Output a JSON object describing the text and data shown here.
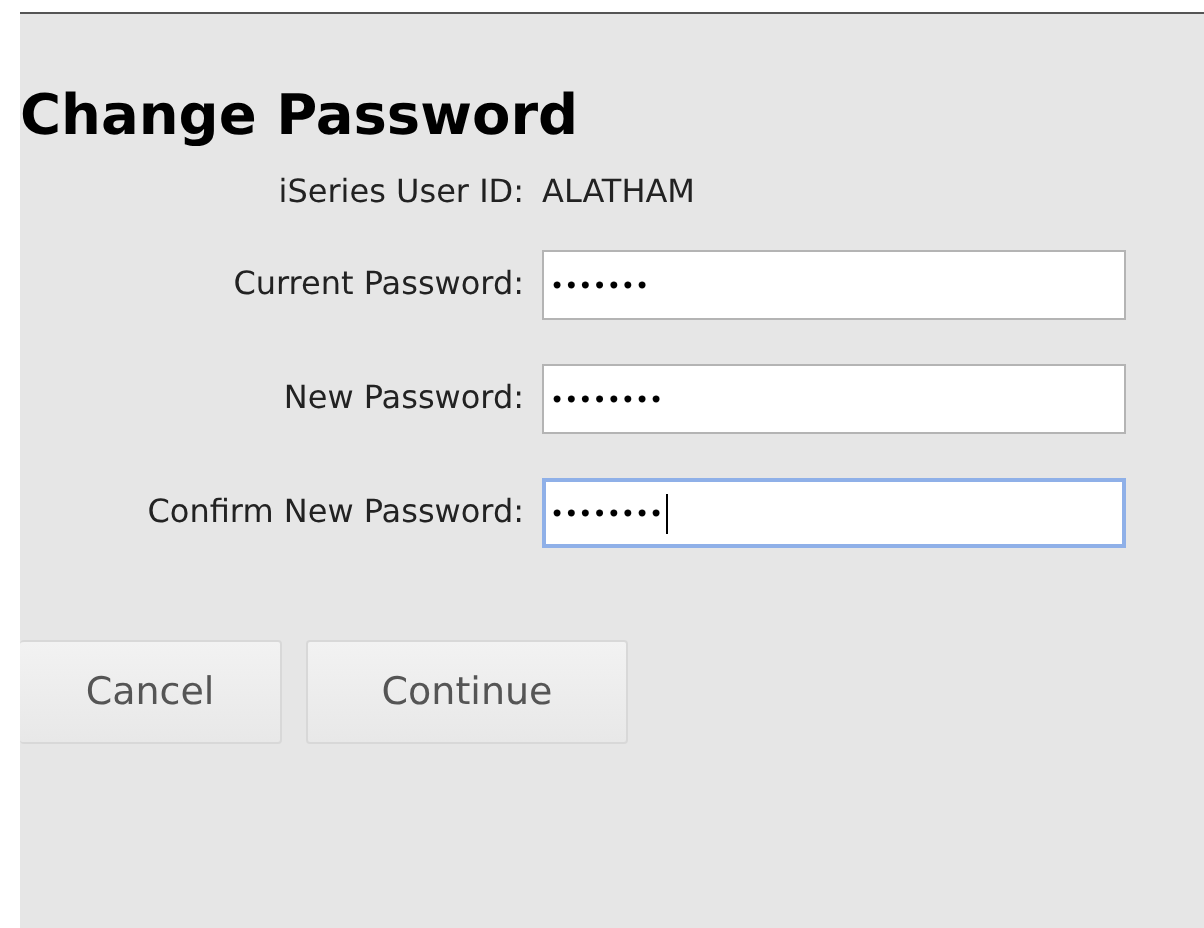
{
  "title": "Change Password",
  "user_id": {
    "label": "iSeries User ID:",
    "value": "ALATHAM"
  },
  "fields": [
    {
      "label": "Current Password:",
      "value": "•••••••",
      "focused": false
    },
    {
      "label": "New Password:",
      "value": "••••••••",
      "focused": false
    },
    {
      "label": "Confirm New Password:",
      "value": "••••••••",
      "focused": true
    }
  ],
  "buttons": [
    {
      "label": "Cancel"
    },
    {
      "label": "Continue"
    }
  ]
}
